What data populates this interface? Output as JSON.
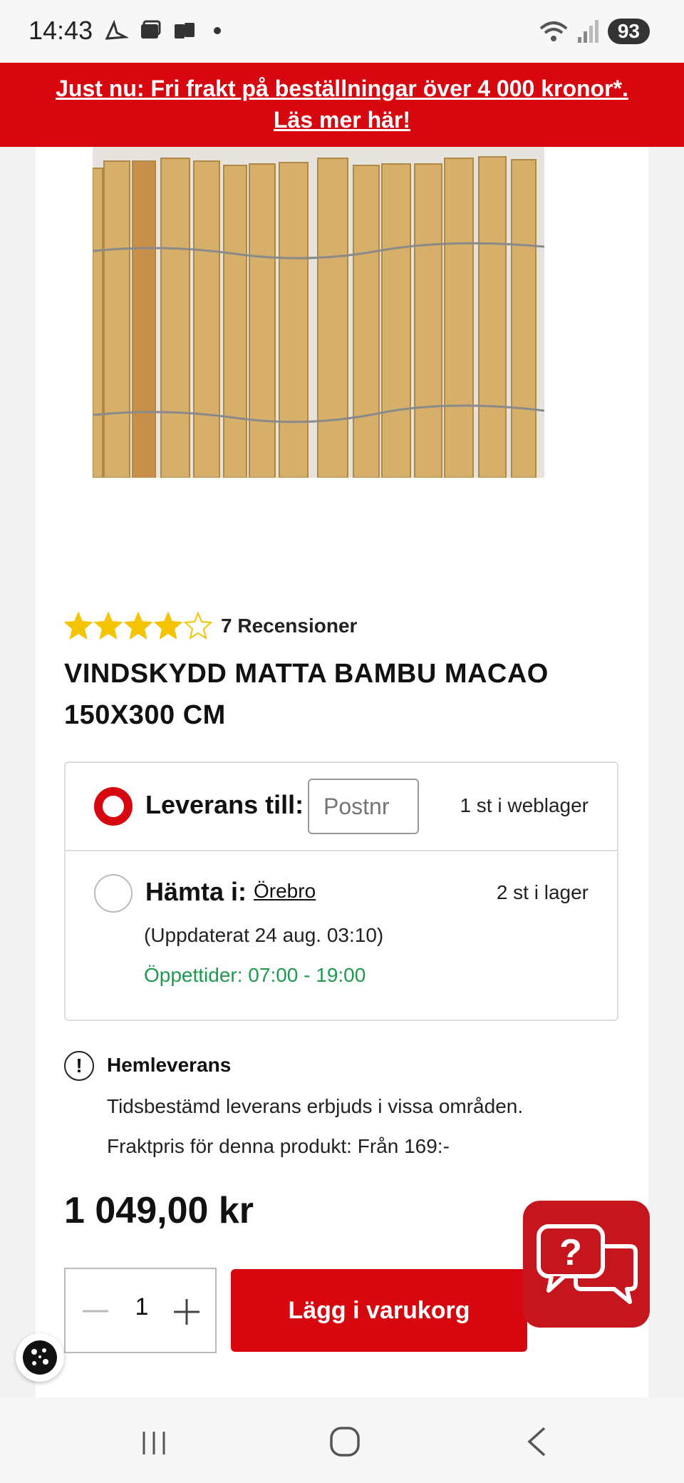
{
  "status_bar": {
    "time": "14:43",
    "battery": "93"
  },
  "promo": {
    "line1": "Just nu: Fri frakt på beställningar över 4 000 kronor*.",
    "line2": "Läs mer här!"
  },
  "product": {
    "rating": 4,
    "rating_max": 5,
    "reviews_label": "7 Recensioner",
    "title_line1": "VINDSKYDD MATTA BAMBU MACAO",
    "title_line2": "150X300 CM",
    "price": "1 049,00 kr"
  },
  "delivery": {
    "ship_label": "Leverans till:",
    "postnr_placeholder": "Postnr",
    "ship_stock": "1 st i weblager",
    "pickup_label": "Hämta i:",
    "store": "Örebro",
    "pickup_stock": "2 st i lager",
    "updated": "(Uppdaterat 24 aug. 03:10)",
    "hours": "Öppettider: 07:00 - 19:00"
  },
  "home_delivery": {
    "title": "Hemleverans",
    "text1": "Tidsbestämd leverans erbjuds i vissa områden.",
    "text2": "Fraktpris för denna produkt: Från 169:-"
  },
  "cart": {
    "quantity": "1",
    "add_label": "Lägg i varukorg"
  },
  "colors": {
    "brand_red": "#d7070f",
    "open_green": "#1e9a4f"
  }
}
